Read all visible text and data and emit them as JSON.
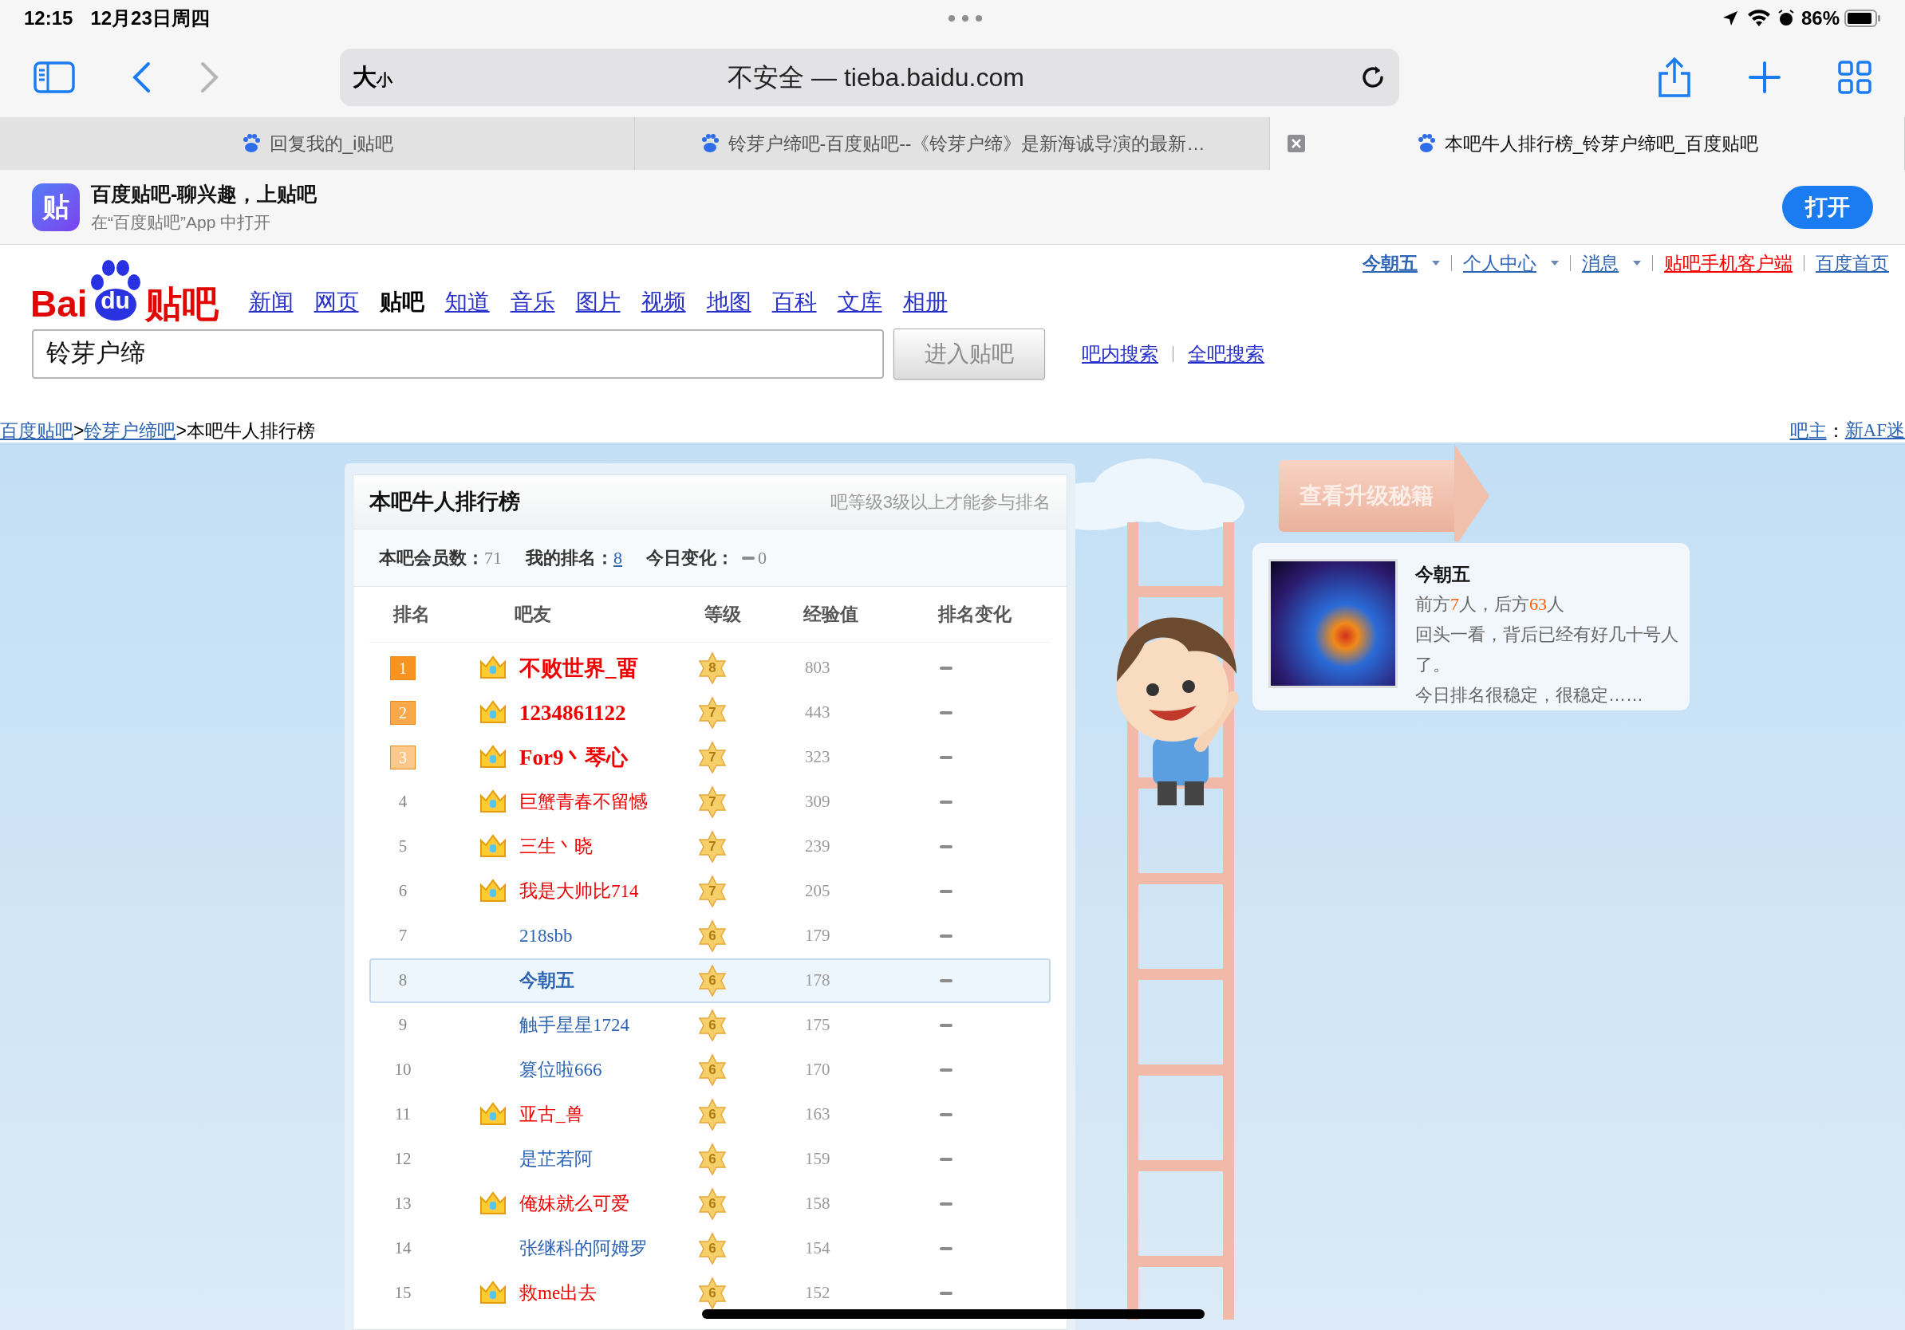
{
  "status_bar": {
    "time": "12:15",
    "date": "12月23日周四",
    "battery": "86%"
  },
  "toolbar": {
    "format_button": {
      "big": "大",
      "small": "小"
    },
    "address": "不安全 — tieba.baidu.com",
    "forward_disabled": true
  },
  "tabs": [
    {
      "title": "回复我的_i贴吧",
      "selected": false
    },
    {
      "title": "铃芽户缔吧-百度贴吧--《铃芽户缔》是新海诚导演的最新…",
      "selected": false
    },
    {
      "title": "本吧牛人排行榜_铃芽户缔吧_百度贴吧",
      "selected": true
    }
  ],
  "app_banner": {
    "icon_text": "贴",
    "title": "百度贴吧-聊兴趣，上贴吧",
    "subtitle": "在“百度贴吧”App 中打开",
    "button": "打开"
  },
  "user_links": [
    {
      "label": "今朝五",
      "dropdown": true,
      "kind": "user"
    },
    {
      "label": "个人中心",
      "dropdown": true,
      "kind": "link"
    },
    {
      "label": "消息",
      "dropdown": true,
      "kind": "link"
    },
    {
      "label": "贴吧手机客户端",
      "dropdown": false,
      "kind": "promo"
    },
    {
      "label": "百度首页",
      "dropdown": false,
      "kind": "link"
    }
  ],
  "logo": {
    "left": "Bai",
    "paw": "du",
    "right": "贴吧"
  },
  "nav": [
    {
      "label": "新闻",
      "selected": false
    },
    {
      "label": "网页",
      "selected": false
    },
    {
      "label": "贴吧",
      "selected": true
    },
    {
      "label": "知道",
      "selected": false
    },
    {
      "label": "音乐",
      "selected": false
    },
    {
      "label": "图片",
      "selected": false
    },
    {
      "label": "视频",
      "selected": false
    },
    {
      "label": "地图",
      "selected": false
    },
    {
      "label": "百科",
      "selected": false
    },
    {
      "label": "文库",
      "selected": false
    },
    {
      "label": "相册",
      "selected": false
    }
  ],
  "search": {
    "value": "铃芽户缔",
    "button": "进入贴吧",
    "links": [
      "吧内搜索",
      "全吧搜索"
    ]
  },
  "breadcrumb": {
    "items": [
      "百度贴吧",
      "铃芽户缔吧"
    ],
    "separator": ">",
    "current": "本吧牛人排行榜",
    "owner_label": "吧主",
    "colon": "：",
    "owner": "新AF迷"
  },
  "ranking": {
    "title": "本吧牛人排行榜",
    "note": "吧等级3级以上才能参与排名",
    "stats": {
      "members_label": "本吧会员数：",
      "members": "71",
      "my_rank_label": "我的排名：",
      "my_rank": "8",
      "change_label": "今日变化：",
      "change": "0"
    },
    "columns": [
      "排名",
      "吧友",
      "等级",
      "经验值",
      "排名变化"
    ],
    "rows": [
      {
        "rank": "1",
        "color": "#f7931e",
        "crown": true,
        "name": "不败世界_畱",
        "vip": true,
        "bold": true,
        "grade": "8",
        "exp": "803",
        "selected": false
      },
      {
        "rank": "2",
        "color": "#f9a94a",
        "crown": true,
        "name": "1234861122",
        "vip": true,
        "bold": true,
        "grade": "7",
        "exp": "443",
        "selected": false
      },
      {
        "rank": "3",
        "color": "#fcc98a",
        "crown": true,
        "name": "For9丶琴心",
        "vip": true,
        "bold": true,
        "grade": "7",
        "exp": "323",
        "selected": false
      },
      {
        "rank": "4",
        "crown": true,
        "name": "巨蟹青春不留憾",
        "vip": true,
        "bold": false,
        "grade": "7",
        "exp": "309",
        "selected": false
      },
      {
        "rank": "5",
        "crown": true,
        "name": "三生丶晓",
        "vip": true,
        "bold": false,
        "grade": "7",
        "exp": "239",
        "selected": false
      },
      {
        "rank": "6",
        "crown": true,
        "name": "我是大帅比714",
        "vip": true,
        "bold": false,
        "grade": "7",
        "exp": "205",
        "selected": false
      },
      {
        "rank": "7",
        "crown": false,
        "name": "218sbb",
        "vip": false,
        "bold": false,
        "grade": "6",
        "exp": "179",
        "selected": false
      },
      {
        "rank": "8",
        "crown": false,
        "name": "今朝五",
        "vip": false,
        "bold": true,
        "grade": "6",
        "exp": "178",
        "selected": true
      },
      {
        "rank": "9",
        "crown": false,
        "name": "触手星星1724",
        "vip": false,
        "bold": false,
        "grade": "6",
        "exp": "175",
        "selected": false
      },
      {
        "rank": "10",
        "crown": false,
        "name": "篡位啦666",
        "vip": false,
        "bold": false,
        "grade": "6",
        "exp": "170",
        "selected": false
      },
      {
        "rank": "11",
        "crown": true,
        "name": "亚古_兽",
        "vip": true,
        "bold": false,
        "grade": "6",
        "exp": "163",
        "selected": false
      },
      {
        "rank": "12",
        "crown": false,
        "name": "是芷若阿",
        "vip": false,
        "bold": false,
        "grade": "6",
        "exp": "159",
        "selected": false
      },
      {
        "rank": "13",
        "crown": true,
        "name": "俺妹就么可爱",
        "vip": true,
        "bold": false,
        "grade": "6",
        "exp": "158",
        "selected": false
      },
      {
        "rank": "14",
        "crown": false,
        "name": "张继科的阿姆罗",
        "vip": false,
        "bold": false,
        "grade": "6",
        "exp": "154",
        "selected": false
      },
      {
        "rank": "15",
        "crown": true,
        "name": "救me出去",
        "vip": true,
        "bold": false,
        "grade": "6",
        "exp": "152",
        "selected": false
      }
    ]
  },
  "upgrade_button": "查看升级秘籍",
  "bubble": {
    "name": "今朝五",
    "position": [
      {
        "text": "前方",
        "highlight": false
      },
      {
        "text": "7",
        "highlight": true
      },
      {
        "text": "人，后方",
        "highlight": false
      },
      {
        "text": "63",
        "highlight": true
      },
      {
        "text": "人",
        "highlight": false
      }
    ],
    "lines": [
      "回头一看，背后已经有好几十号人了。",
      "今日排名很稳定，很稳定……"
    ]
  }
}
